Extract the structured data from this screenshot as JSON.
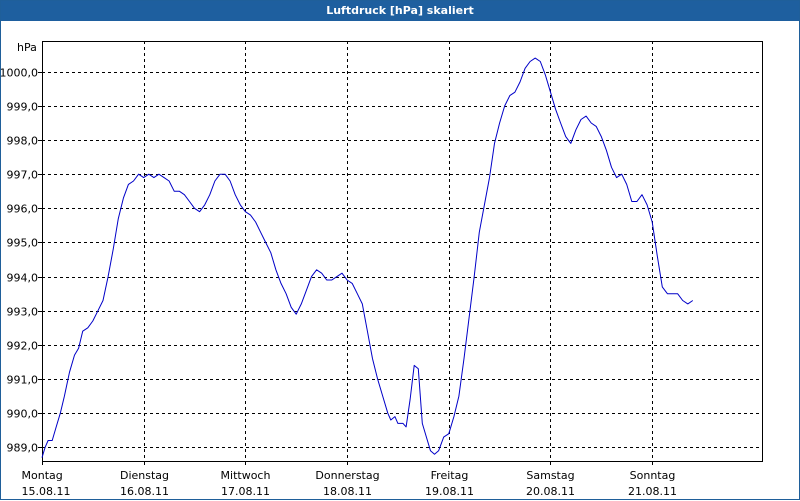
{
  "window": {
    "title": "Luftdruck [hPa] skaliert"
  },
  "colors": {
    "titlebar": "#1e5f9f",
    "line": "#0000c8",
    "grid": "#000000"
  },
  "chart_data": {
    "type": "line",
    "title": "Luftdruck [hPa] skaliert",
    "ylabel": "hPa",
    "xlabel": "",
    "ylim": [
      988.6,
      1000.9
    ],
    "xlim": [
      0,
      7.08
    ],
    "grid": true,
    "yticks": [
      {
        "value": 989,
        "label": "989,0"
      },
      {
        "value": 990,
        "label": "990,0"
      },
      {
        "value": 991,
        "label": "991,0"
      },
      {
        "value": 992,
        "label": "992,0"
      },
      {
        "value": 993,
        "label": "993,0"
      },
      {
        "value": 994,
        "label": "994,0"
      },
      {
        "value": 995,
        "label": "995,0"
      },
      {
        "value": 996,
        "label": "996,0"
      },
      {
        "value": 997,
        "label": "997,0"
      },
      {
        "value": 998,
        "label": "998,0"
      },
      {
        "value": 999,
        "label": "999,0"
      },
      {
        "value": 1000,
        "label": "1000,0"
      }
    ],
    "xticks": [
      {
        "x": 0,
        "day": "Montag",
        "date": "15.08.11"
      },
      {
        "x": 1,
        "day": "Dienstag",
        "date": "16.08.11"
      },
      {
        "x": 2,
        "day": "Mittwoch",
        "date": "17.08.11"
      },
      {
        "x": 3,
        "day": "Donnerstag",
        "date": "18.08.11"
      },
      {
        "x": 4,
        "day": "Freitag",
        "date": "19.08.11"
      },
      {
        "x": 5,
        "day": "Samstag",
        "date": "20.08.11"
      },
      {
        "x": 6,
        "day": "Sonntag",
        "date": "21.08.11"
      }
    ],
    "series": [
      {
        "values": [
          [
            0.0,
            988.7
          ],
          [
            0.03,
            989.0
          ],
          [
            0.06,
            989.2
          ],
          [
            0.1,
            989.2
          ],
          [
            0.14,
            989.6
          ],
          [
            0.18,
            990.0
          ],
          [
            0.22,
            990.5
          ],
          [
            0.27,
            991.2
          ],
          [
            0.32,
            991.7
          ],
          [
            0.36,
            991.9
          ],
          [
            0.4,
            992.4
          ],
          [
            0.45,
            992.5
          ],
          [
            0.5,
            992.7
          ],
          [
            0.55,
            993.0
          ],
          [
            0.6,
            993.3
          ],
          [
            0.65,
            994.0
          ],
          [
            0.7,
            994.8
          ],
          [
            0.75,
            995.7
          ],
          [
            0.8,
            996.3
          ],
          [
            0.85,
            996.7
          ],
          [
            0.9,
            996.8
          ],
          [
            0.95,
            997.0
          ],
          [
            1.0,
            996.9
          ],
          [
            1.05,
            997.0
          ],
          [
            1.1,
            996.9
          ],
          [
            1.15,
            997.0
          ],
          [
            1.2,
            996.9
          ],
          [
            1.25,
            996.8
          ],
          [
            1.3,
            996.5
          ],
          [
            1.35,
            996.5
          ],
          [
            1.4,
            996.4
          ],
          [
            1.45,
            996.2
          ],
          [
            1.5,
            996.0
          ],
          [
            1.55,
            995.9
          ],
          [
            1.6,
            996.1
          ],
          [
            1.65,
            996.4
          ],
          [
            1.7,
            996.8
          ],
          [
            1.75,
            997.0
          ],
          [
            1.8,
            997.0
          ],
          [
            1.85,
            996.8
          ],
          [
            1.9,
            996.4
          ],
          [
            1.95,
            996.1
          ],
          [
            2.0,
            995.9
          ],
          [
            2.05,
            995.8
          ],
          [
            2.1,
            995.6
          ],
          [
            2.15,
            995.3
          ],
          [
            2.2,
            995.0
          ],
          [
            2.25,
            994.7
          ],
          [
            2.3,
            994.2
          ],
          [
            2.35,
            993.8
          ],
          [
            2.4,
            993.5
          ],
          [
            2.45,
            993.1
          ],
          [
            2.5,
            992.9
          ],
          [
            2.55,
            993.2
          ],
          [
            2.6,
            993.6
          ],
          [
            2.65,
            994.0
          ],
          [
            2.7,
            994.2
          ],
          [
            2.75,
            994.1
          ],
          [
            2.8,
            993.9
          ],
          [
            2.85,
            993.9
          ],
          [
            2.9,
            994.0
          ],
          [
            2.95,
            994.1
          ],
          [
            3.0,
            993.9
          ],
          [
            3.05,
            993.8
          ],
          [
            3.1,
            993.5
          ],
          [
            3.15,
            993.2
          ],
          [
            3.2,
            992.4
          ],
          [
            3.25,
            991.6
          ],
          [
            3.3,
            991.0
          ],
          [
            3.35,
            990.5
          ],
          [
            3.4,
            990.0
          ],
          [
            3.43,
            989.8
          ],
          [
            3.47,
            989.9
          ],
          [
            3.5,
            989.7
          ],
          [
            3.55,
            989.7
          ],
          [
            3.58,
            989.6
          ],
          [
            3.62,
            990.4
          ],
          [
            3.66,
            991.4
          ],
          [
            3.7,
            991.3
          ],
          [
            3.74,
            989.7
          ],
          [
            3.78,
            989.3
          ],
          [
            3.82,
            988.9
          ],
          [
            3.86,
            988.8
          ],
          [
            3.9,
            988.9
          ],
          [
            3.95,
            989.3
          ],
          [
            4.0,
            989.4
          ],
          [
            4.05,
            989.9
          ],
          [
            4.1,
            990.5
          ],
          [
            4.15,
            991.6
          ],
          [
            4.2,
            992.8
          ],
          [
            4.25,
            994.0
          ],
          [
            4.3,
            995.3
          ],
          [
            4.35,
            996.1
          ],
          [
            4.4,
            996.9
          ],
          [
            4.45,
            997.9
          ],
          [
            4.5,
            998.5
          ],
          [
            4.55,
            999.0
          ],
          [
            4.6,
            999.3
          ],
          [
            4.65,
            999.4
          ],
          [
            4.7,
            999.7
          ],
          [
            4.75,
            1000.1
          ],
          [
            4.8,
            1000.3
          ],
          [
            4.85,
            1000.4
          ],
          [
            4.9,
            1000.3
          ],
          [
            4.95,
            999.9
          ],
          [
            5.0,
            999.4
          ],
          [
            5.05,
            998.9
          ],
          [
            5.1,
            998.5
          ],
          [
            5.15,
            998.1
          ],
          [
            5.2,
            997.9
          ],
          [
            5.25,
            998.3
          ],
          [
            5.3,
            998.6
          ],
          [
            5.35,
            998.7
          ],
          [
            5.4,
            998.5
          ],
          [
            5.45,
            998.4
          ],
          [
            5.5,
            998.1
          ],
          [
            5.55,
            997.7
          ],
          [
            5.6,
            997.2
          ],
          [
            5.65,
            996.9
          ],
          [
            5.7,
            997.0
          ],
          [
            5.75,
            996.7
          ],
          [
            5.8,
            996.2
          ],
          [
            5.85,
            996.2
          ],
          [
            5.9,
            996.4
          ],
          [
            5.95,
            996.1
          ],
          [
            6.0,
            995.6
          ],
          [
            6.05,
            994.6
          ],
          [
            6.1,
            993.7
          ],
          [
            6.15,
            993.5
          ],
          [
            6.2,
            993.5
          ],
          [
            6.25,
            993.5
          ],
          [
            6.3,
            993.3
          ],
          [
            6.35,
            993.2
          ],
          [
            6.4,
            993.3
          ]
        ]
      }
    ]
  }
}
